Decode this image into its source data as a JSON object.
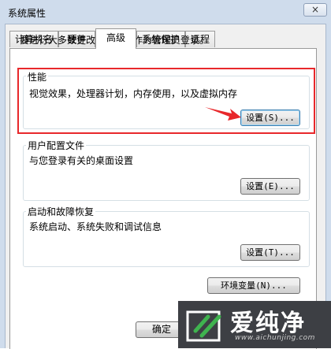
{
  "window": {
    "title": "系统属性",
    "close_label": "×"
  },
  "tabs": [
    {
      "label": "计算机名"
    },
    {
      "label": "硬件"
    },
    {
      "label": "高级"
    },
    {
      "label": "系统保护"
    },
    {
      "label": "远程"
    }
  ],
  "note": "要进行大多数更改，您必须作为管理员登录。",
  "groups": {
    "performance": {
      "title": "性能",
      "description": "视觉效果，处理器计划，内存使用，以及虚拟内存",
      "button": "设置(S)..."
    },
    "user_profiles": {
      "title": "用户配置文件",
      "description": "与您登录有关的桌面设置",
      "button": "设置(E)..."
    },
    "startup_recovery": {
      "title": "启动和故障恢复",
      "description": "系统启动、系统失败和调试信息",
      "button": "设置(T)..."
    }
  },
  "env_button": "环境变量(N)...",
  "ok_button": "确定",
  "watermark": {
    "name": "爱纯净",
    "url": "www.aichunjing.com"
  },
  "colors": {
    "highlight": "#e8282b",
    "accent_focus": "#3c7fb1"
  }
}
